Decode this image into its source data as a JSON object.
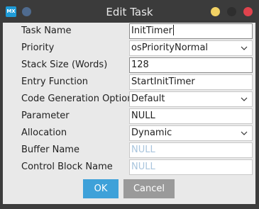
{
  "window": {
    "title": "Edit Task",
    "logo_text": "MX"
  },
  "form": {
    "rows": [
      {
        "label": "Task Name",
        "value": "InitTimer",
        "kind": "text-focused"
      },
      {
        "label": "Priority",
        "value": "osPriorityNormal",
        "kind": "combo"
      },
      {
        "label": "Stack Size (Words)",
        "value": "128",
        "kind": "text-framed"
      },
      {
        "label": "Entry Function",
        "value": "StartInitTimer",
        "kind": "text"
      },
      {
        "label": "Code Generation Option",
        "value": "Default",
        "kind": "combo"
      },
      {
        "label": "Parameter",
        "value": "NULL",
        "kind": "text"
      },
      {
        "label": "Allocation",
        "value": "Dynamic",
        "kind": "combo"
      },
      {
        "label": "Buffer Name",
        "value": "NULL",
        "kind": "placeholder"
      },
      {
        "label": "Control Block Name",
        "value": "NULL",
        "kind": "placeholder"
      }
    ]
  },
  "buttons": {
    "ok": "OK",
    "cancel": "Cancel"
  },
  "colors": {
    "titlebar": "#3b3b3b",
    "client_bg": "#e9e9e9",
    "ok_bg": "#3ea1d9",
    "cancel_bg": "#9a9a9a",
    "close": "#e0434d",
    "minimize": "#f2d264",
    "placeholder_text": "#a9c5dd"
  },
  "icons": {
    "logo": "stm32cubemx-logo-icon",
    "menu": "window-menu-dot-icon",
    "minimize": "minimize-dot-icon",
    "maximize": "maximize-dot-icon",
    "close": "close-dot-icon",
    "dropdown": "chevron-down-icon"
  }
}
